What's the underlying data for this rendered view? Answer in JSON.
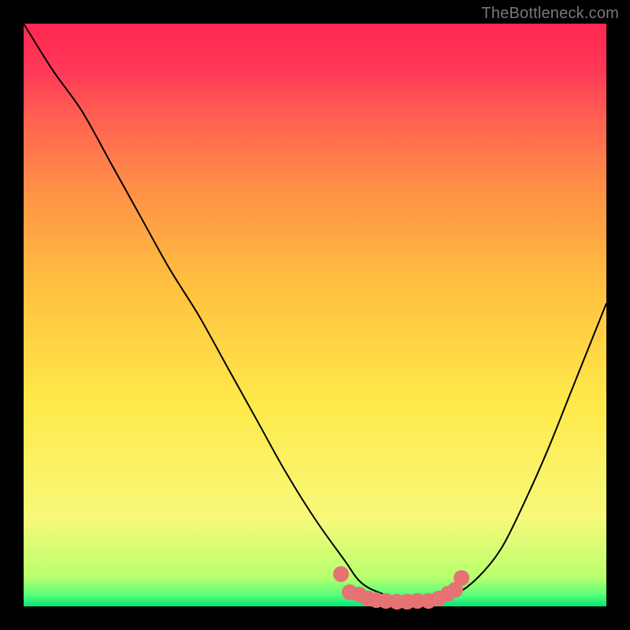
{
  "watermark": "TheBottleneck.com",
  "chart_data": {
    "type": "line",
    "title": "",
    "xlabel": "",
    "ylabel": "",
    "xlim": [
      0,
      1
    ],
    "ylim": [
      0,
      1
    ],
    "grid": false,
    "legend": false,
    "background_gradient": {
      "direction": "vertical",
      "stops": [
        {
          "pos": 0.0,
          "color": "#00e676"
        },
        {
          "pos": 0.02,
          "color": "#5aff7a"
        },
        {
          "pos": 0.05,
          "color": "#b8ff6e"
        },
        {
          "pos": 0.15,
          "color": "#f7f97a"
        },
        {
          "pos": 0.35,
          "color": "#ffe94a"
        },
        {
          "pos": 0.55,
          "color": "#ffc040"
        },
        {
          "pos": 0.72,
          "color": "#ff8f47"
        },
        {
          "pos": 0.84,
          "color": "#ff6052"
        },
        {
          "pos": 0.92,
          "color": "#ff3858"
        },
        {
          "pos": 1.0,
          "color": "#ff2851"
        }
      ]
    },
    "series": [
      {
        "name": "bottleneck-curve",
        "color": "#000000",
        "stroke_width": 2,
        "x": [
          0.0,
          0.05,
          0.1,
          0.15,
          0.2,
          0.25,
          0.3,
          0.35,
          0.4,
          0.45,
          0.5,
          0.55,
          0.58,
          0.62,
          0.66,
          0.7,
          0.74,
          0.78,
          0.82,
          0.86,
          0.9,
          0.94,
          0.98,
          1.0
        ],
        "y": [
          1.0,
          0.92,
          0.85,
          0.76,
          0.67,
          0.58,
          0.5,
          0.41,
          0.32,
          0.23,
          0.15,
          0.08,
          0.04,
          0.02,
          0.01,
          0.01,
          0.02,
          0.05,
          0.1,
          0.18,
          0.27,
          0.37,
          0.47,
          0.52
        ]
      }
    ],
    "marker_points": {
      "comment": "salmon dots near the bottom of the curve",
      "color": "#e57373",
      "radius_px": 10,
      "points": [
        {
          "x": 0.545,
          "y": 0.055
        },
        {
          "x": 0.56,
          "y": 0.025
        },
        {
          "x": 0.575,
          "y": 0.02
        },
        {
          "x": 0.59,
          "y": 0.013
        },
        {
          "x": 0.605,
          "y": 0.011
        },
        {
          "x": 0.622,
          "y": 0.009
        },
        {
          "x": 0.64,
          "y": 0.008
        },
        {
          "x": 0.658,
          "y": 0.008
        },
        {
          "x": 0.676,
          "y": 0.009
        },
        {
          "x": 0.694,
          "y": 0.01
        },
        {
          "x": 0.712,
          "y": 0.013
        },
        {
          "x": 0.728,
          "y": 0.022
        },
        {
          "x": 0.74,
          "y": 0.028
        },
        {
          "x": 0.752,
          "y": 0.048
        }
      ]
    }
  }
}
